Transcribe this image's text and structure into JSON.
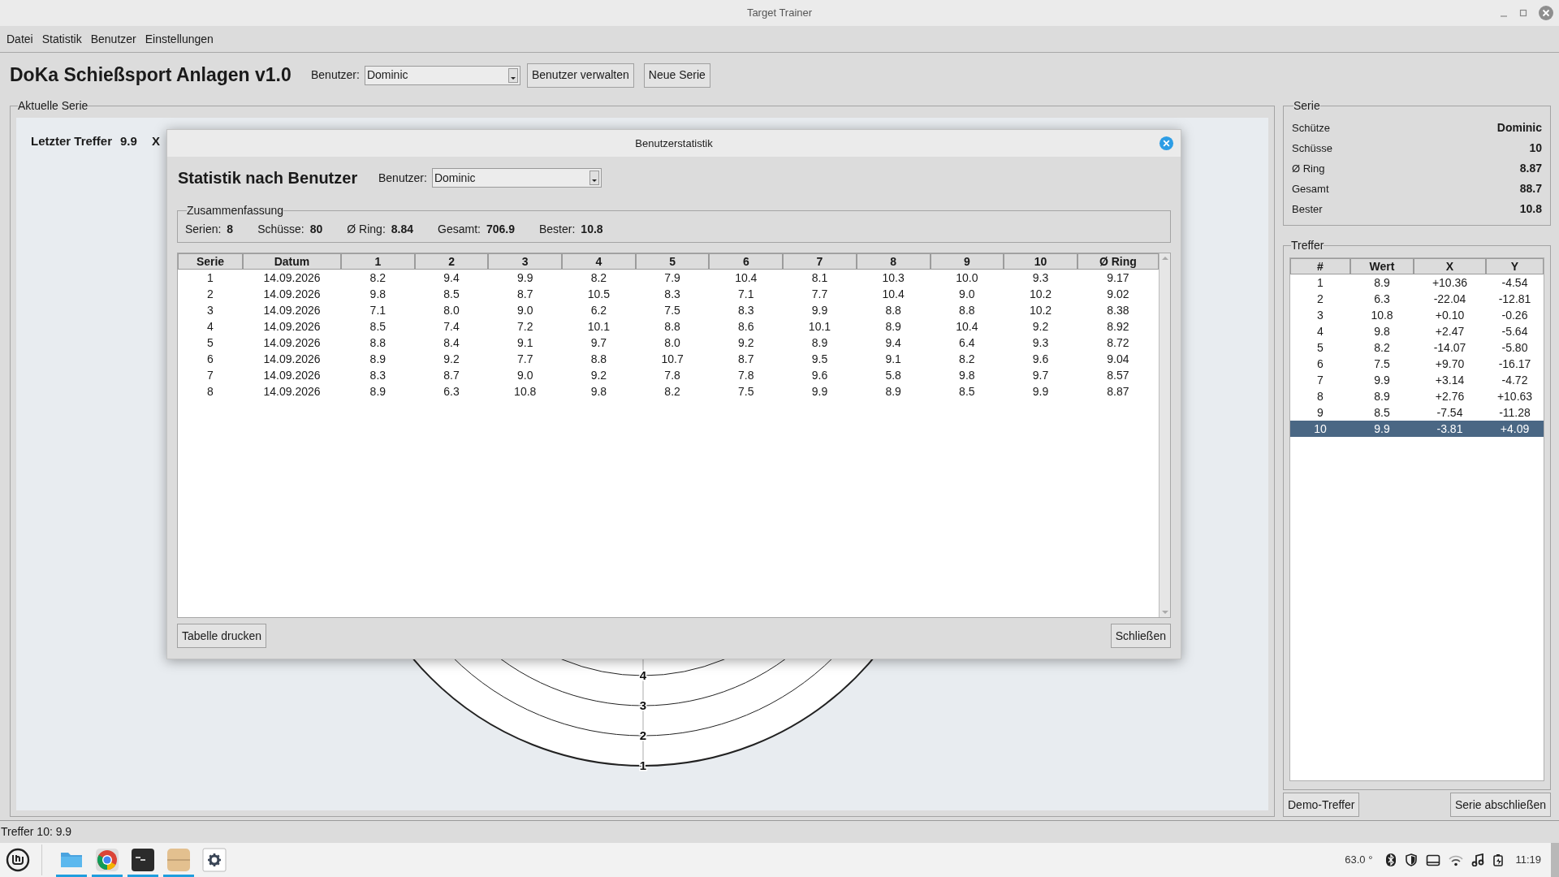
{
  "window": {
    "title": "Target Trainer"
  },
  "menu": [
    "Datei",
    "Statistik",
    "Benutzer",
    "Einstellungen"
  ],
  "header": {
    "app_title": "DoKa Schießsport Anlagen v1.0",
    "user_label": "Benutzer:",
    "user_value": "Dominic",
    "buttons": [
      "Benutzer verwalten",
      "Neue Serie"
    ]
  },
  "current_series": {
    "title": "Aktuelle Serie",
    "last_hit_label": "Letzter Treffer",
    "last_hit_value": "9.9",
    "x_label": "X",
    "ring_labels": [
      "4",
      "3",
      "2",
      "1"
    ]
  },
  "dialog": {
    "title": "Benutzerstatistik",
    "heading": "Statistik nach Benutzer",
    "user_label": "Benutzer:",
    "user_value": "Dominic",
    "summary": {
      "title": "Zusammenfassung",
      "items": [
        {
          "label": "Serien:",
          "value": "8"
        },
        {
          "label": "Schüsse:",
          "value": "80"
        },
        {
          "label": "Ø Ring:",
          "value": "8.84"
        },
        {
          "label": "Gesamt:",
          "value": "706.9"
        },
        {
          "label": "Bester:",
          "value": "10.8"
        }
      ]
    },
    "table": {
      "columns": [
        "Serie",
        "Datum",
        "1",
        "2",
        "3",
        "4",
        "5",
        "6",
        "7",
        "8",
        "9",
        "10",
        "Ø Ring"
      ],
      "rows": [
        [
          "1",
          "14.09.2026",
          "8.2",
          "9.4",
          "9.9",
          "8.2",
          "7.9",
          "10.4",
          "8.1",
          "10.3",
          "10.0",
          "9.3",
          "9.17"
        ],
        [
          "2",
          "14.09.2026",
          "9.8",
          "8.5",
          "8.7",
          "10.5",
          "8.3",
          "7.1",
          "7.7",
          "10.4",
          "9.0",
          "10.2",
          "9.02"
        ],
        [
          "3",
          "14.09.2026",
          "7.1",
          "8.0",
          "9.0",
          "6.2",
          "7.5",
          "8.3",
          "9.9",
          "8.8",
          "8.8",
          "10.2",
          "8.38"
        ],
        [
          "4",
          "14.09.2026",
          "8.5",
          "7.4",
          "7.2",
          "10.1",
          "8.8",
          "8.6",
          "10.1",
          "8.9",
          "10.4",
          "9.2",
          "8.92"
        ],
        [
          "5",
          "14.09.2026",
          "8.8",
          "8.4",
          "9.1",
          "9.7",
          "8.0",
          "9.2",
          "8.9",
          "9.4",
          "6.4",
          "9.3",
          "8.72"
        ],
        [
          "6",
          "14.09.2026",
          "8.9",
          "9.2",
          "7.7",
          "8.8",
          "10.7",
          "8.7",
          "9.5",
          "9.1",
          "8.2",
          "9.6",
          "9.04"
        ],
        [
          "7",
          "14.09.2026",
          "8.3",
          "8.7",
          "9.0",
          "9.2",
          "7.8",
          "7.8",
          "9.6",
          "5.8",
          "9.8",
          "9.7",
          "8.57"
        ],
        [
          "8",
          "14.09.2026",
          "8.9",
          "6.3",
          "10.8",
          "9.8",
          "8.2",
          "7.5",
          "9.9",
          "8.9",
          "8.5",
          "9.9",
          "8.87"
        ]
      ]
    },
    "buttons": {
      "print": "Tabelle drucken",
      "close": "Schließen"
    }
  },
  "series_panel": {
    "title": "Serie",
    "rows": [
      {
        "label": "Schütze",
        "value": "Dominic"
      },
      {
        "label": "Schüsse",
        "value": "10"
      },
      {
        "label": "Ø Ring",
        "value": "8.87"
      },
      {
        "label": "Gesamt",
        "value": "88.7"
      },
      {
        "label": "Bester",
        "value": "10.8"
      }
    ]
  },
  "hits_panel": {
    "title": "Treffer",
    "columns": [
      "#",
      "Wert",
      "X",
      "Y"
    ],
    "rows": [
      {
        "cells": [
          "1",
          "8.9",
          "+10.36",
          "-4.54"
        ],
        "selected": false
      },
      {
        "cells": [
          "2",
          "6.3",
          "-22.04",
          "-12.81"
        ],
        "selected": false
      },
      {
        "cells": [
          "3",
          "10.8",
          "+0.10",
          "-0.26"
        ],
        "selected": false
      },
      {
        "cells": [
          "4",
          "9.8",
          "+2.47",
          "-5.64"
        ],
        "selected": false
      },
      {
        "cells": [
          "5",
          "8.2",
          "-14.07",
          "-5.80"
        ],
        "selected": false
      },
      {
        "cells": [
          "6",
          "7.5",
          "+9.70",
          "-16.17"
        ],
        "selected": false
      },
      {
        "cells": [
          "7",
          "9.9",
          "+3.14",
          "-4.72"
        ],
        "selected": false
      },
      {
        "cells": [
          "8",
          "8.9",
          "+2.76",
          "+10.63"
        ],
        "selected": false
      },
      {
        "cells": [
          "9",
          "8.5",
          "-7.54",
          "-11.28"
        ],
        "selected": false
      },
      {
        "cells": [
          "10",
          "9.9",
          "-3.81",
          "+4.09"
        ],
        "selected": true
      }
    ]
  },
  "panel_buttons": [
    "Demo-Treffer",
    "Serie abschließen"
  ],
  "status_bar": "Treffer 10: 9.9",
  "taskbar": {
    "apps": [
      {
        "kind": "folder",
        "running": true
      },
      {
        "kind": "browser",
        "running": true
      },
      {
        "kind": "terminal",
        "running": true
      },
      {
        "kind": "box",
        "running": true
      },
      {
        "kind": "settings",
        "running": false
      }
    ],
    "temperature": "63.0 °",
    "clock": "11:19"
  }
}
